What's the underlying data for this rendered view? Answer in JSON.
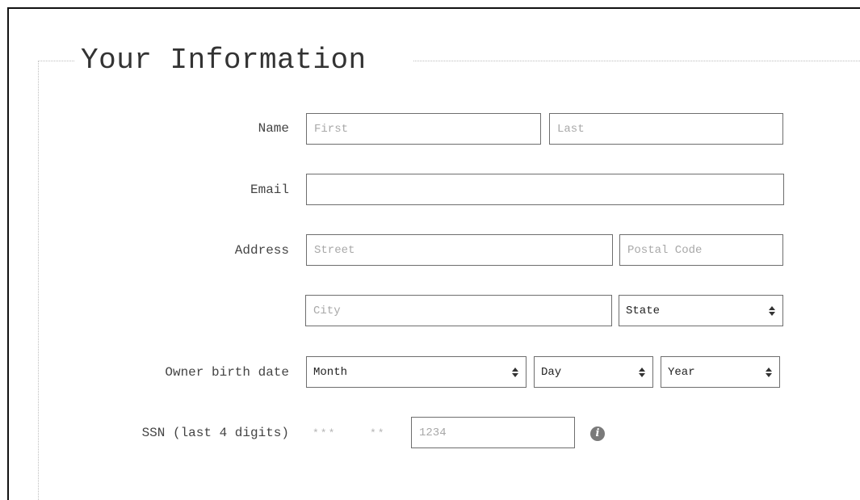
{
  "section": {
    "legend": "Your Information"
  },
  "name": {
    "label": "Name",
    "first_placeholder": "First",
    "last_placeholder": "Last"
  },
  "email": {
    "label": "Email",
    "value": ""
  },
  "address": {
    "label": "Address",
    "street_placeholder": "Street",
    "postal_placeholder": "Postal Code",
    "city_placeholder": "City",
    "state_selected": "State"
  },
  "birth_date": {
    "label": "Owner birth date",
    "month_selected": "Month",
    "day_selected": "Day",
    "year_selected": "Year"
  },
  "ssn": {
    "label": "SSN (last 4 digits)",
    "mask_first": "***",
    "mask_second": "**",
    "last4_placeholder": "1234",
    "info_icon_glyph": "i"
  },
  "icons": {
    "select_arrows": "up-down-caret-icon",
    "info": "info-icon"
  },
  "colors": {
    "border": "#6e6e6e",
    "placeholder": "#a8a8a8",
    "text": "#333333",
    "dotted_border": "#bdbdbd",
    "info_icon_bg": "#7a7a7a"
  }
}
